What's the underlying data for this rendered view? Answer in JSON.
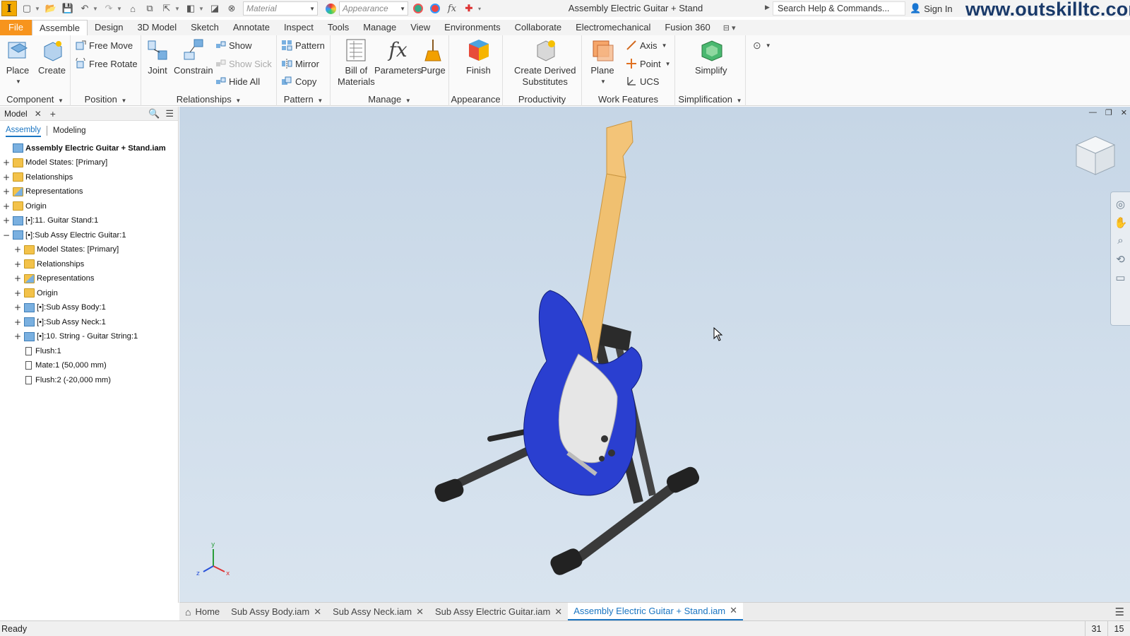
{
  "app": {
    "title": "Assembly Electric Guitar + Stand",
    "logo_letter": "I",
    "watermark": "www.outskilltc.com",
    "search_placeholder": "Search Help & Commands...",
    "sign_in": "Sign In",
    "material_combo": "Material",
    "appearance_combo": "Appearance"
  },
  "tabs": [
    "File",
    "Assemble",
    "Design",
    "3D Model",
    "Sketch",
    "Annotate",
    "Inspect",
    "Tools",
    "Manage",
    "View",
    "Environments",
    "Collaborate",
    "Electromechanical",
    "Fusion 360"
  ],
  "active_tab": "Assemble",
  "ribbon": {
    "component": {
      "title": "Component",
      "place": "Place",
      "create": "Create"
    },
    "position": {
      "title": "Position",
      "free_move": "Free Move",
      "free_rotate": "Free Rotate"
    },
    "relationships": {
      "title": "Relationships",
      "joint": "Joint",
      "constrain": "Constrain",
      "show": "Show",
      "show_sick": "Show Sick",
      "hide_all": "Hide All"
    },
    "pattern": {
      "title": "Pattern",
      "pattern": "Pattern",
      "mirror": "Mirror",
      "copy": "Copy"
    },
    "manage": {
      "title": "Manage",
      "bom_line1": "Bill of",
      "bom_line2": "Materials",
      "parameters": "Parameters",
      "purge": "Purge"
    },
    "appearance": {
      "title": "Appearance",
      "finish": "Finish"
    },
    "productivity": {
      "title": "Productivity",
      "cds_line1": "Create Derived",
      "cds_line2": "Substitutes"
    },
    "work_features": {
      "title": "Work Features",
      "plane": "Plane",
      "axis": "Axis",
      "point": "Point",
      "ucs": "UCS"
    },
    "simplification": {
      "title": "Simplification",
      "simplify": "Simplify"
    }
  },
  "browser": {
    "tab_label": "Model",
    "subtabs": [
      "Assembly",
      "Modeling"
    ],
    "tree": [
      {
        "label": "Assembly Electric Guitar + Stand.iam",
        "level": 0,
        "icon": "assembly-icon",
        "expander": ""
      },
      {
        "label": "Model States: [Primary]",
        "level": 0,
        "icon": "folder-icon",
        "expander": "+"
      },
      {
        "label": "Relationships",
        "level": 0,
        "icon": "folder-icon",
        "expander": "+"
      },
      {
        "label": "Representations",
        "level": 0,
        "icon": "representations-icon",
        "expander": "+"
      },
      {
        "label": "Origin",
        "level": 0,
        "icon": "folder-icon",
        "expander": "+"
      },
      {
        "label": "[•]:11. Guitar Stand:1",
        "level": 0,
        "icon": "part-icon",
        "expander": "+"
      },
      {
        "label": "[•]:Sub Assy Electric Guitar:1",
        "level": 0,
        "icon": "assembly-icon",
        "expander": "−"
      },
      {
        "label": "Model States: [Primary]",
        "level": 1,
        "icon": "folder-icon",
        "expander": "+"
      },
      {
        "label": "Relationships",
        "level": 1,
        "icon": "folder-icon",
        "expander": "+"
      },
      {
        "label": "Representations",
        "level": 1,
        "icon": "representations-icon",
        "expander": "+"
      },
      {
        "label": "Origin",
        "level": 1,
        "icon": "folder-icon",
        "expander": "+"
      },
      {
        "label": "[•]:Sub Assy Body:1",
        "level": 1,
        "icon": "part-icon",
        "expander": "+"
      },
      {
        "label": "[•]:Sub Assy Neck:1",
        "level": 1,
        "icon": "assembly-icon",
        "expander": "+"
      },
      {
        "label": "[•]:10. String - Guitar String:1",
        "level": 1,
        "icon": "part-icon",
        "expander": "+"
      },
      {
        "label": "Flush:1",
        "level": 1,
        "icon": "constraint-icon",
        "expander": ""
      },
      {
        "label": "Mate:1 (50,000 mm)",
        "level": 1,
        "icon": "constraint-icon",
        "expander": ""
      },
      {
        "label": "Flush:2 (-20,000 mm)",
        "level": 1,
        "icon": "constraint-icon",
        "expander": ""
      }
    ]
  },
  "doc_tabs": [
    {
      "label": "Home",
      "closable": false
    },
    {
      "label": "Sub Assy Body.iam",
      "closable": true
    },
    {
      "label": "Sub Assy Neck.iam",
      "closable": true
    },
    {
      "label": "Sub Assy Electric Guitar.iam",
      "closable": true
    },
    {
      "label": "Assembly Electric Guitar + Stand.iam",
      "closable": true
    }
  ],
  "active_doc": "Assembly Electric Guitar + Stand.iam",
  "status": {
    "text": "Ready",
    "count1": "31",
    "count2": "15"
  },
  "triad": {
    "x": "x",
    "y": "y",
    "z": "z"
  },
  "colors": {
    "accent": "#1a75c2",
    "file_tab": "#f7941d",
    "guitar_body": "#2a3fd0",
    "fretboard": "#f0c070"
  }
}
